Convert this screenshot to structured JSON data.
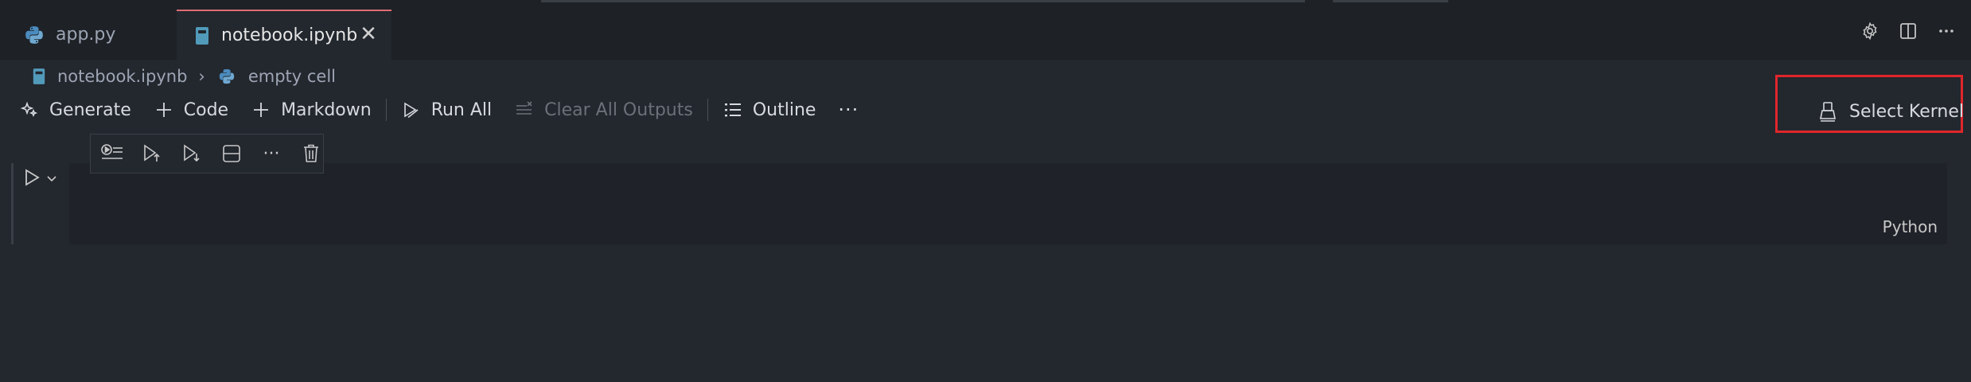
{
  "tabs": [
    {
      "label": "app.py",
      "icon": "python-icon",
      "active": false
    },
    {
      "label": "notebook.ipynb",
      "icon": "notebook-icon",
      "active": true,
      "close_icon": "close-icon"
    }
  ],
  "editor_actions": [
    "settings-icon",
    "split-editor-icon",
    "more-actions-icon"
  ],
  "breadcrumb": {
    "file": "notebook.ipynb",
    "cell": "empty cell"
  },
  "toolbar": {
    "generate": "Generate",
    "code": "Code",
    "markdown": "Markdown",
    "run_all": "Run All",
    "clear_outputs": "Clear All Outputs",
    "outline": "Outline",
    "more": "···"
  },
  "kernel": {
    "label": "Select Kernel"
  },
  "cell": {
    "language": "Python",
    "toolbar_more": "···"
  },
  "colors": {
    "active_tab_accent": "#e06c75",
    "highlight_box": "#e0262b",
    "background": "#23272e"
  }
}
